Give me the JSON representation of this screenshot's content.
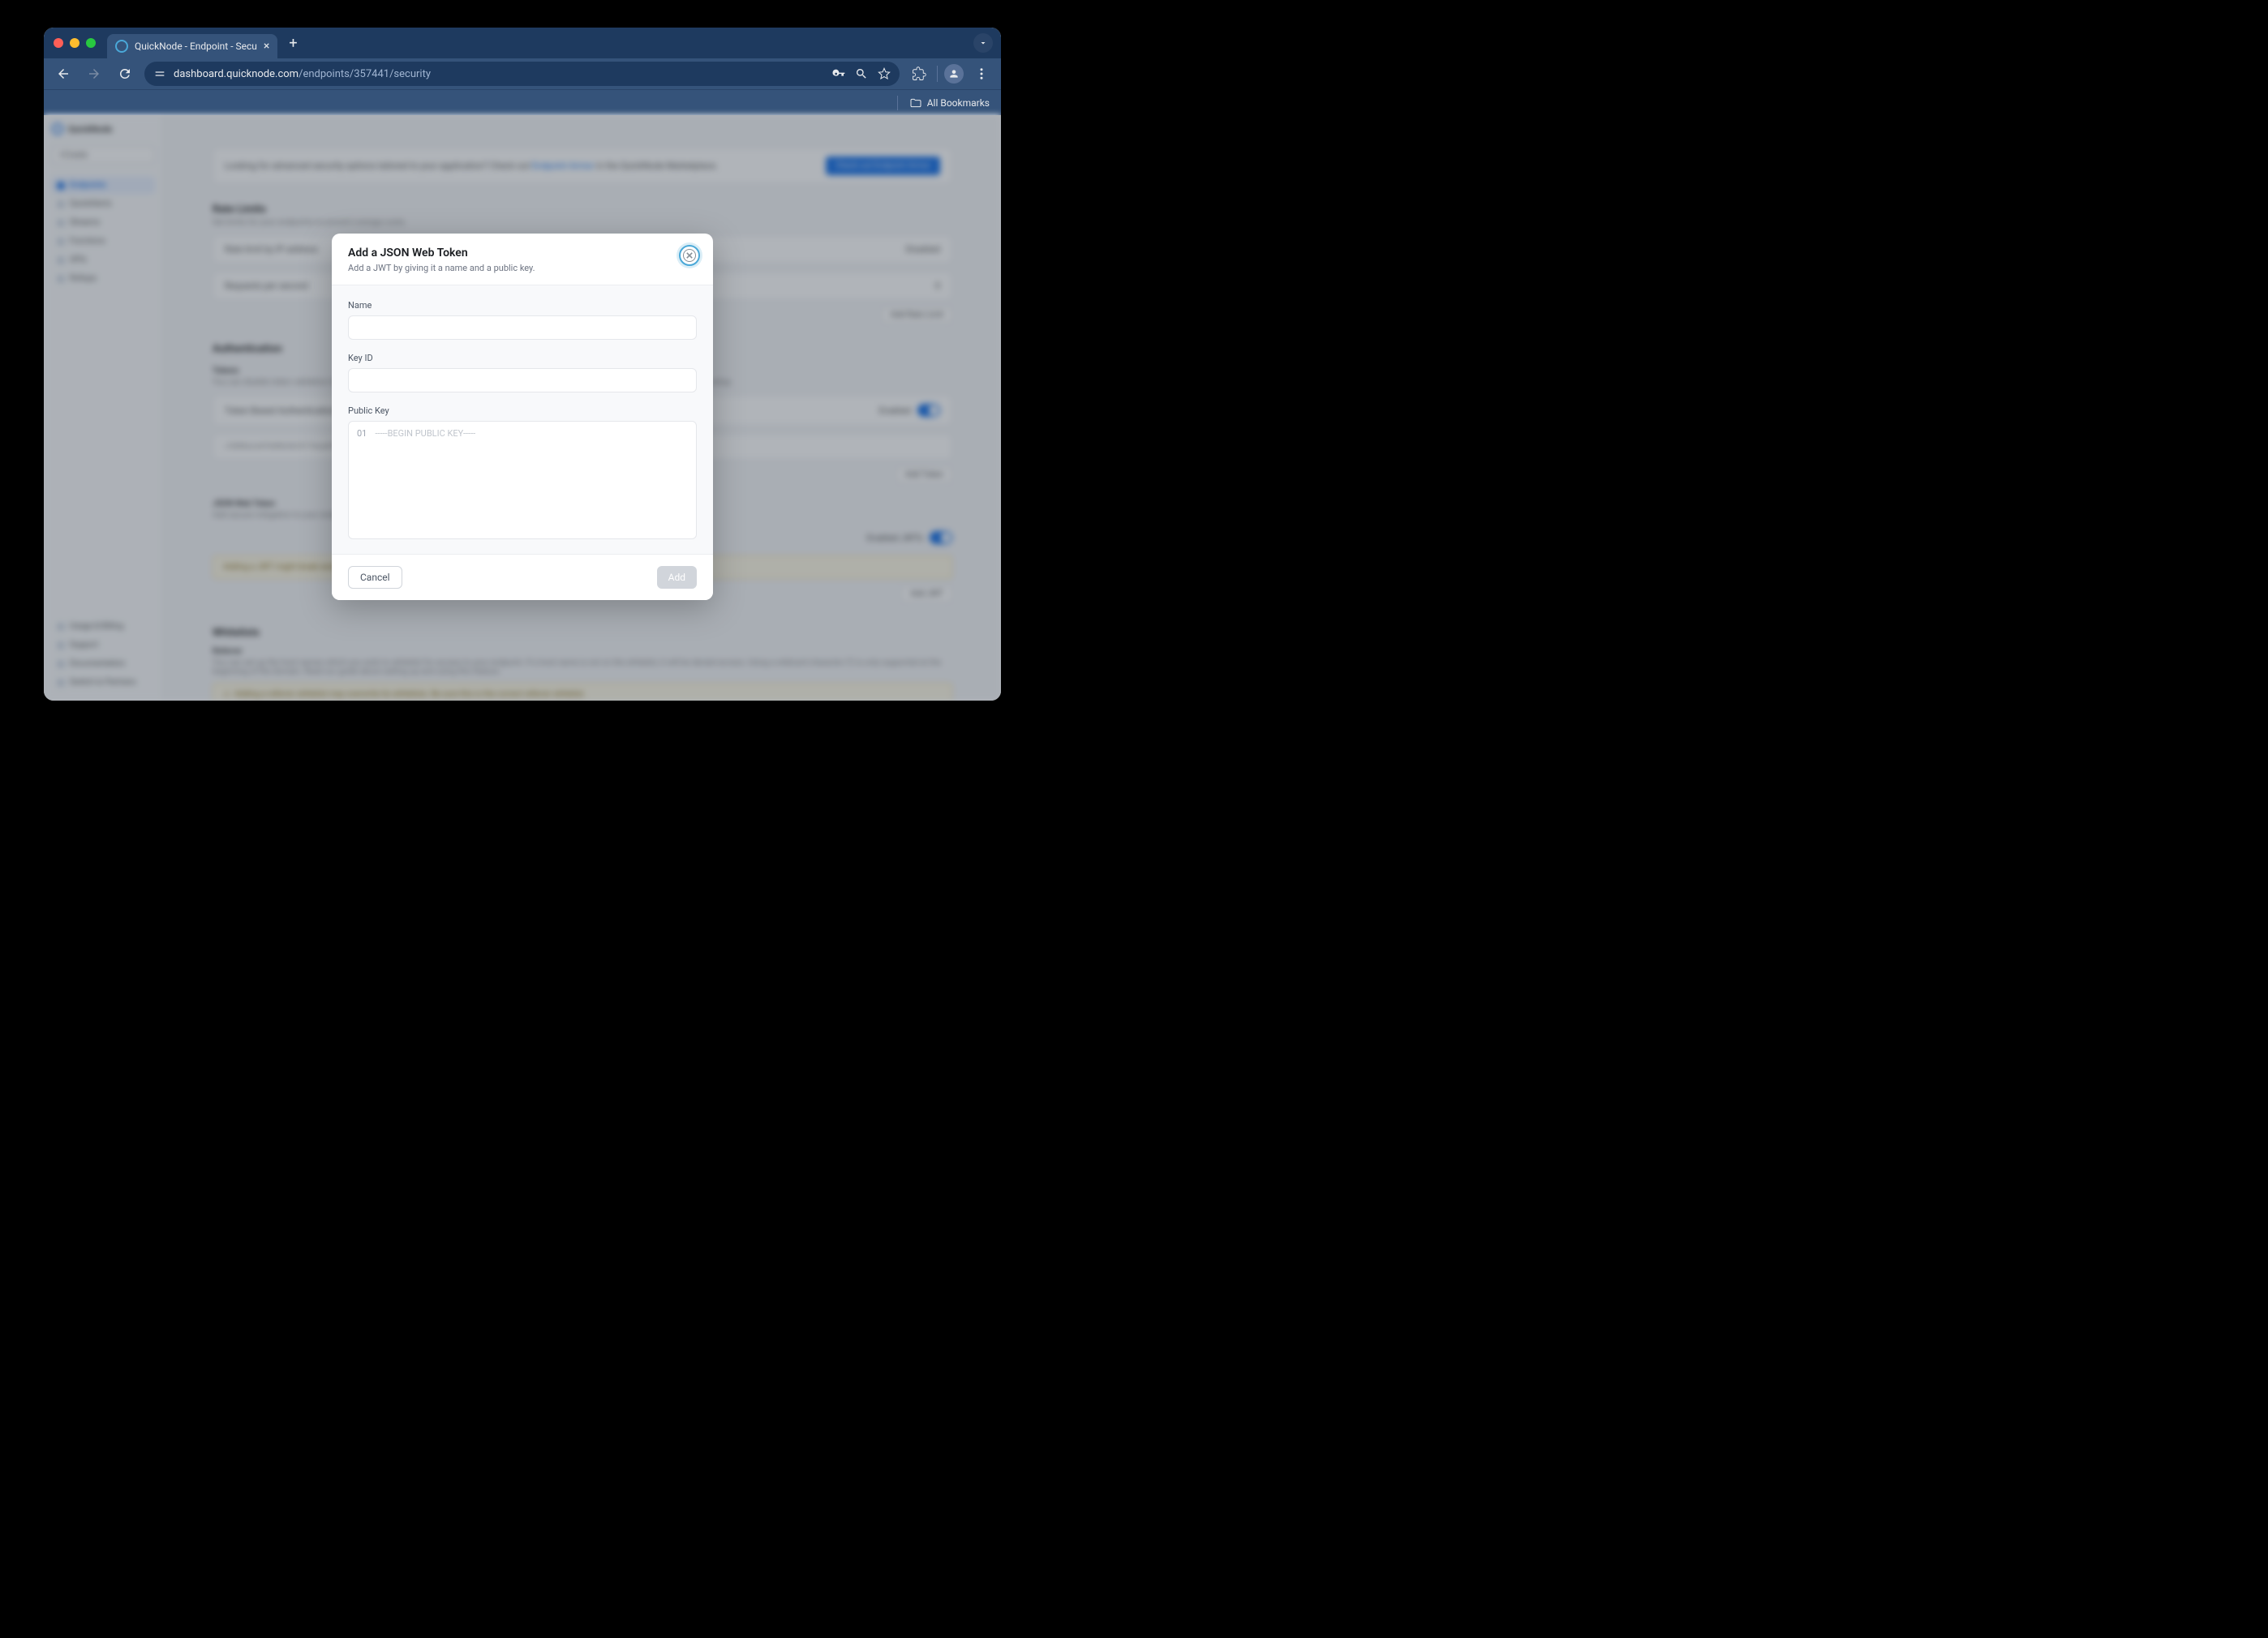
{
  "browser": {
    "tab_title": "QuickNode - Endpoint - Secu",
    "url_host": "dashboard.quicknode.com",
    "url_path": "/endpoints/357441/security",
    "bookmarks_label": "All Bookmarks"
  },
  "sidebar": {
    "brand": "QuickNode",
    "create_label": "Create",
    "items": [
      {
        "label": "Endpoints",
        "active": true
      },
      {
        "label": "QuickAlerts",
        "active": false
      },
      {
        "label": "Streams",
        "active": false
      },
      {
        "label": "Functions",
        "active": false
      },
      {
        "label": "APIs",
        "active": false
      },
      {
        "label": "Rollups",
        "active": false
      }
    ],
    "bottom_items": [
      {
        "label": "Usage & Billing"
      },
      {
        "label": "Support"
      },
      {
        "label": "Documentation"
      },
      {
        "label": "Switch to Partners"
      }
    ]
  },
  "page": {
    "banner_text": "Looking for advanced security options tailored to your application? Check out ",
    "banner_link": "Endpoint Armor",
    "banner_suffix": " in the QuickNode Marketplace.",
    "banner_cta": "Check out Endpoint Armor",
    "sections": {
      "rate_limits": {
        "title": "Rate Limits",
        "subtitle": "Set limits for your endpoints to prevent overage costs.",
        "row1": "Rate limit by IP address",
        "row1_badge": "Disabled",
        "row2": "Requests per second",
        "row2_value": "0",
        "add_label": "Add Rate Limit"
      },
      "auth": {
        "title": "Authentication",
        "tokens_title": "Tokens",
        "tokens_sub": "You can disable token validation here. This is not recommended as it will allow anyone to make requests to your endpoint without whitelist setup.",
        "toggle_label": "Token Based Authentication",
        "toggle_badge": "Enabled",
        "add_token": "Add Token",
        "jwt_title": "JSON Web Token",
        "jwt_sub": "Add secure mitigation to your endpoint by requiring a JWT with every request.",
        "jwt_toggle": "Enabled JWTs",
        "jwt_warning": "Adding a JWT might break existing applications using this endpoint.",
        "add_jwt": "Add JWT"
      },
      "whitelists": {
        "title": "Whitelists",
        "referrer_title": "Referrer",
        "referrer_text": "You can set up the host names which you wish to whitelist for access to your endpoint. If a host name is not on the whitelist, it will be denied access. Using a wildcard character (*) is only supported at the beginning of the domain. Read our guide about setting up and using this feature."
      }
    }
  },
  "modal": {
    "title": "Add a JSON Web Token",
    "subtitle": "Add a JWT by giving it a name and a public key.",
    "name_label": "Name",
    "keyid_label": "Key ID",
    "publickey_label": "Public Key",
    "publickey_placeholder": "-----BEGIN PUBLIC KEY-----",
    "line_number": "01",
    "cancel": "Cancel",
    "add": "Add"
  }
}
